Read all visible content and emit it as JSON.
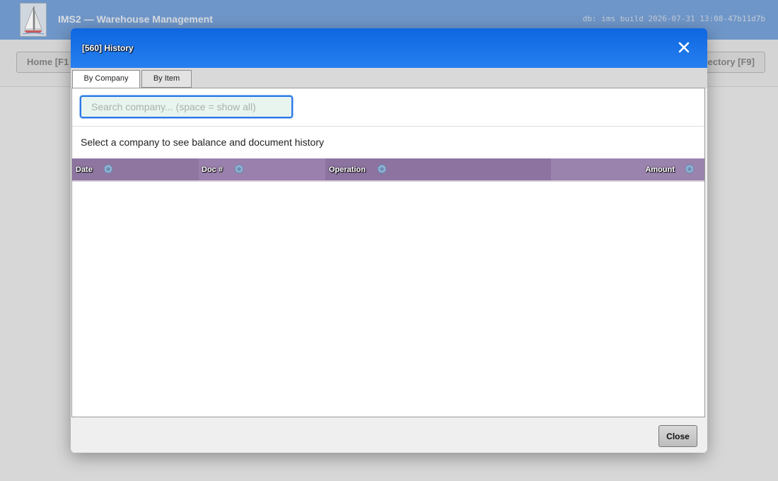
{
  "app": {
    "title": "IMS2 — Warehouse Management",
    "build_info": "db: ims  build 2026-07-31 13:08-47b11d7b",
    "nav": {
      "home_label": "Home [F1",
      "directory_label": "ectory [F9]"
    }
  },
  "modal": {
    "title": "[560] History",
    "close_icon": "close-icon",
    "tabs": [
      {
        "label": "By Company",
        "active": true
      },
      {
        "label": "By Item",
        "active": false
      }
    ],
    "search": {
      "placeholder": "Search company... (space = show all)",
      "value": ""
    },
    "hint": "Select a company to see balance and document history",
    "grid": {
      "columns": [
        {
          "label": "Date",
          "icon": "gear-icon"
        },
        {
          "label": "Doc #",
          "icon": "gear-icon"
        },
        {
          "label": "Operation",
          "icon": "gear-icon"
        },
        {
          "label": "Amount",
          "icon": "gear-icon",
          "align": "right"
        }
      ],
      "rows": []
    },
    "footer": {
      "close_label": "Close"
    }
  },
  "colors": {
    "titlebar": "#1a74e8",
    "grid_header": "#957ba6",
    "search_bg": "#e8f5ee",
    "search_border": "#2a78e8"
  }
}
